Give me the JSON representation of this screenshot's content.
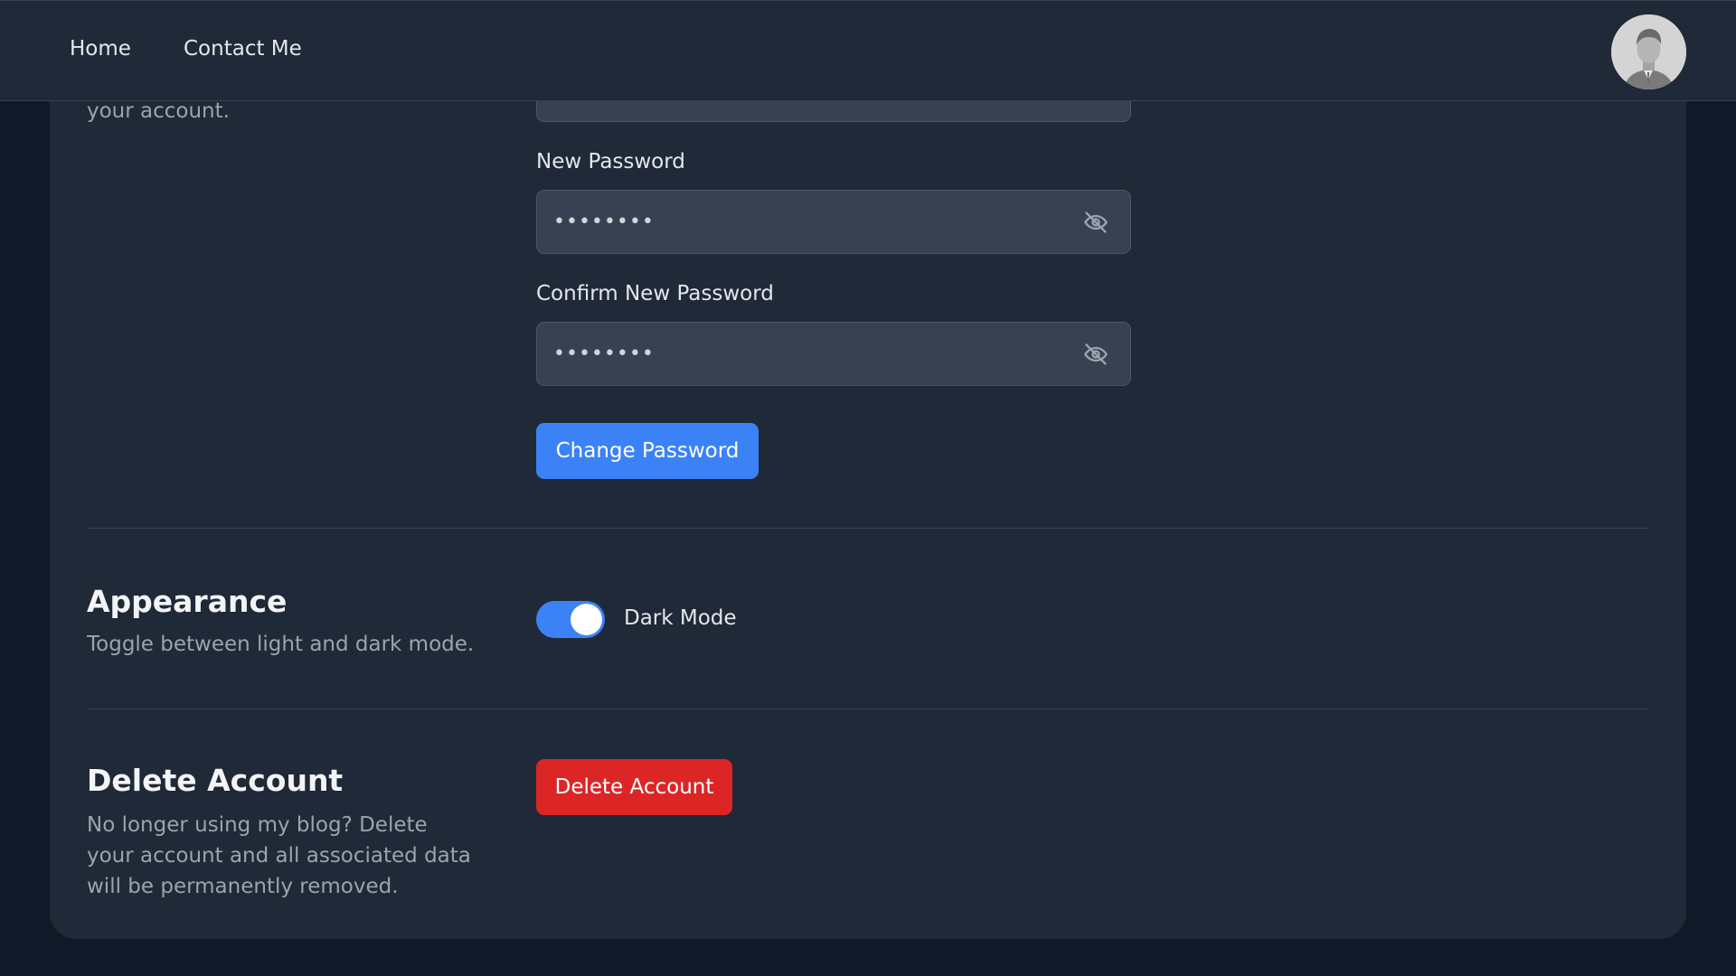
{
  "nav": {
    "home_label": "Home",
    "contact_label": "Contact Me"
  },
  "password_section": {
    "desc_tail": "your account.",
    "new_password_label": "New Password",
    "new_password_value": "••••••••",
    "confirm_password_label": "Confirm New Password",
    "confirm_password_value": "••••••••",
    "submit_label": "Change Password",
    "visibility_icon": "eye-off-icon"
  },
  "appearance_section": {
    "title": "Appearance",
    "description": "Toggle between light and dark mode.",
    "toggle_label": "Dark Mode",
    "toggle_on": true
  },
  "delete_section": {
    "title": "Delete Account",
    "description": "No longer using my blog? Delete your account and all associated data will be permanently removed.",
    "button_label": "Delete Account"
  },
  "colors": {
    "page_bg": "#111827",
    "card_bg": "#1f2937",
    "input_bg": "#374151",
    "primary": "#3b82f6",
    "danger": "#dc2626"
  }
}
